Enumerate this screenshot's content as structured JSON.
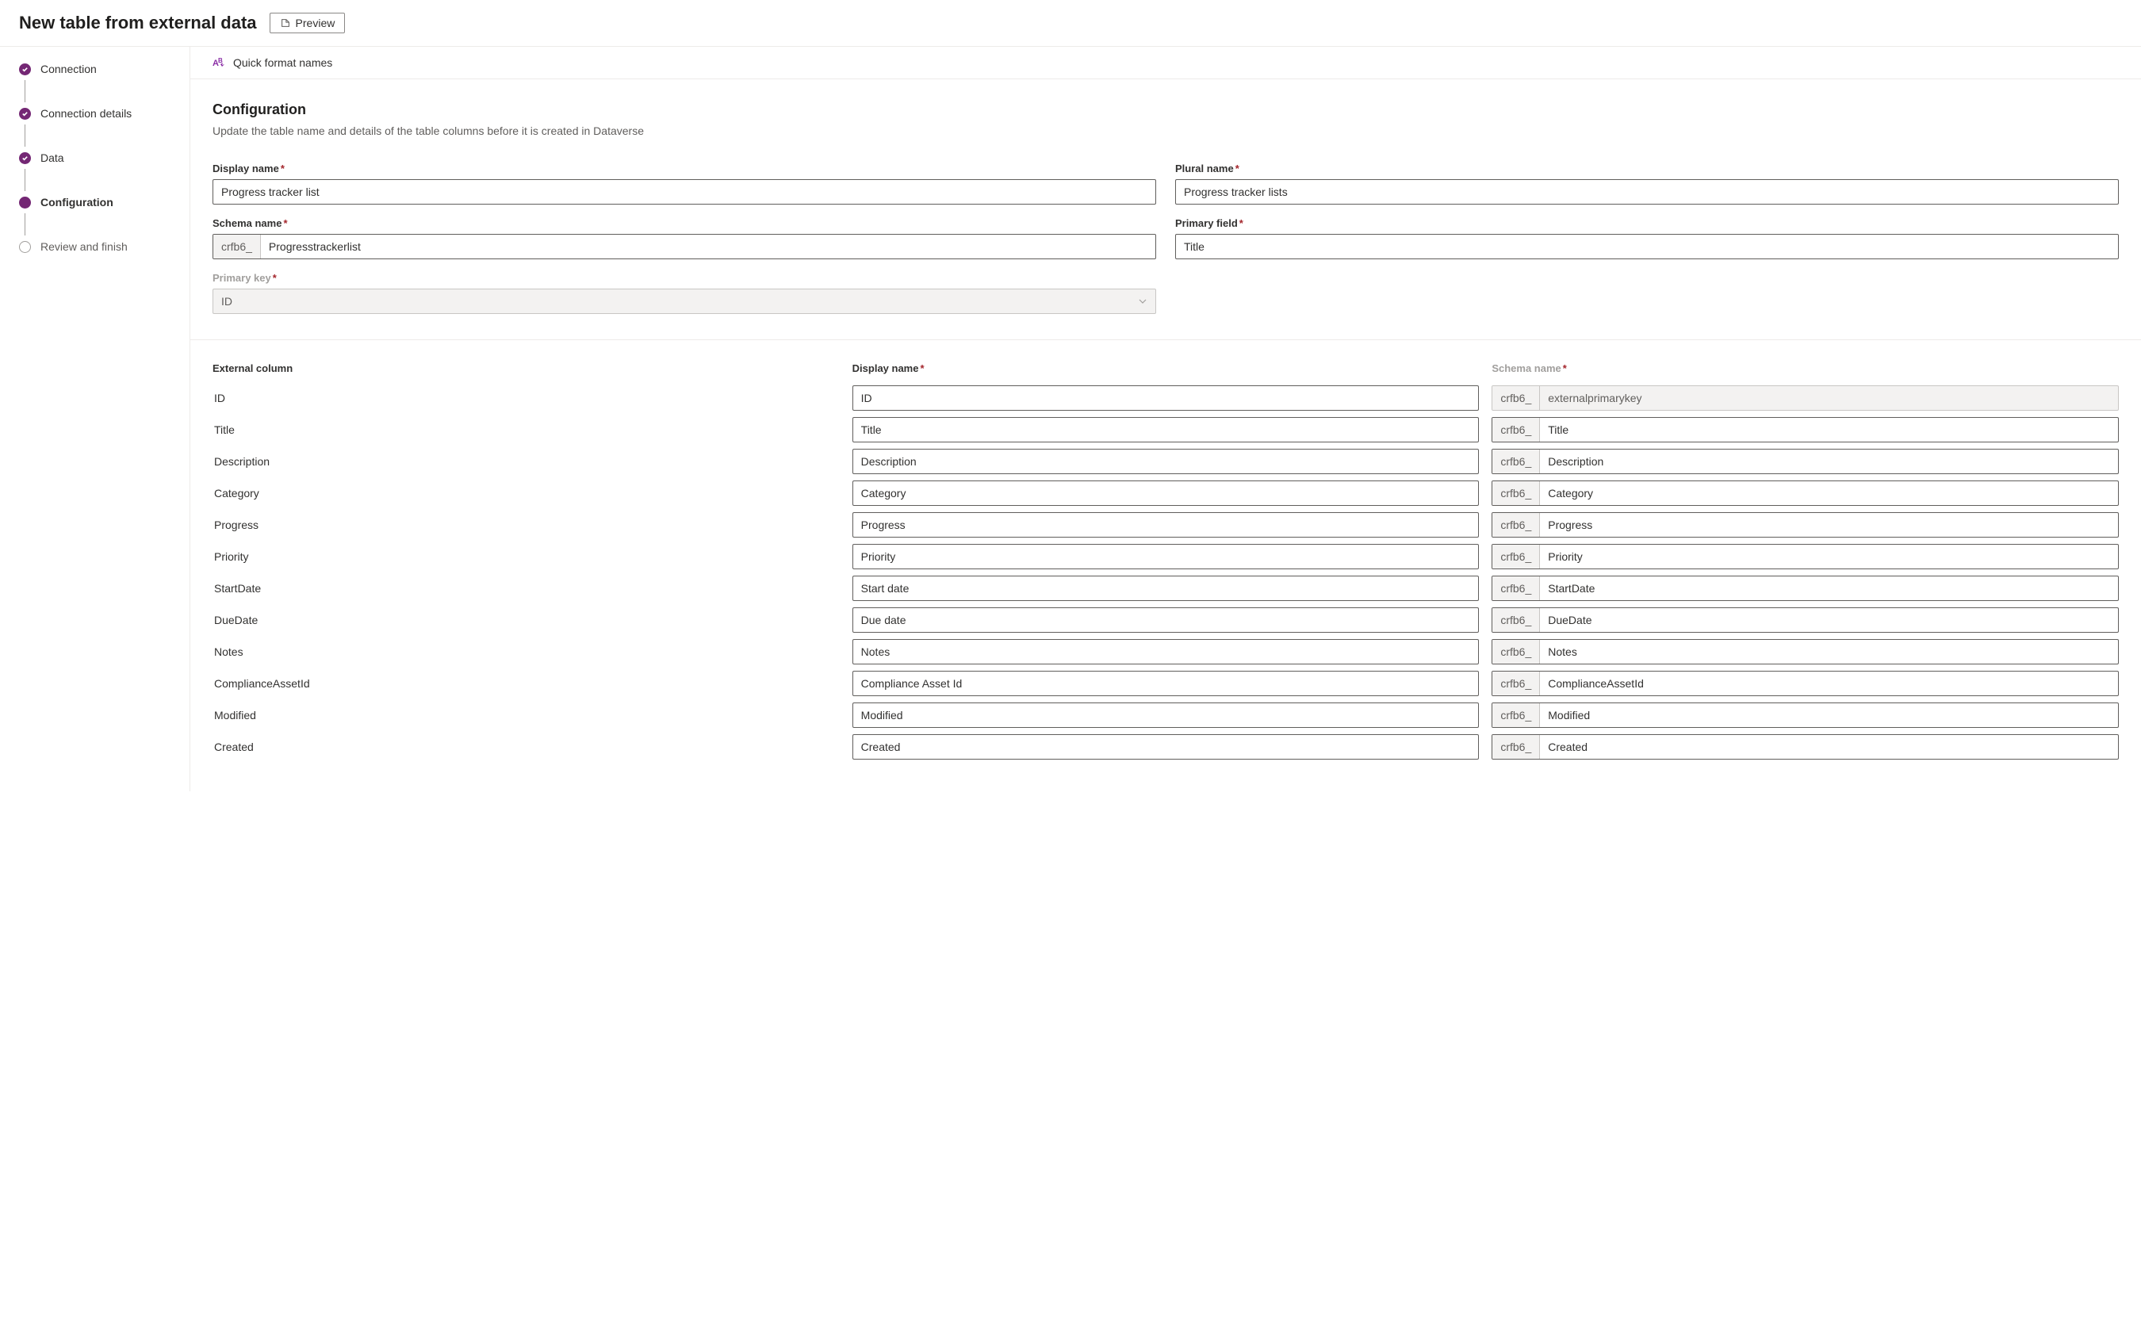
{
  "header": {
    "title": "New table from external data",
    "preview_label": "Preview"
  },
  "stepper": {
    "items": [
      {
        "label": "Connection",
        "state": "completed"
      },
      {
        "label": "Connection details",
        "state": "completed"
      },
      {
        "label": "Data",
        "state": "completed"
      },
      {
        "label": "Configuration",
        "state": "current"
      },
      {
        "label": "Review and finish",
        "state": "upcoming"
      }
    ]
  },
  "toolbar": {
    "quick_format_label": "Quick format names"
  },
  "configuration": {
    "title": "Configuration",
    "description": "Update the table name and details of the table columns before it is created in Dataverse",
    "labels": {
      "display_name": "Display name",
      "plural_name": "Plural name",
      "schema_name": "Schema name",
      "primary_field": "Primary field",
      "primary_key": "Primary key"
    },
    "values": {
      "display_name": "Progress tracker list",
      "plural_name": "Progress tracker lists",
      "schema_prefix": "crfb6_",
      "schema_name": "Progresstrackerlist",
      "primary_field": "Title",
      "primary_key": "ID"
    }
  },
  "columns": {
    "headers": {
      "external": "External column",
      "display": "Display name",
      "schema": "Schema name"
    },
    "schema_prefix": "crfb6_",
    "rows": [
      {
        "ext": "ID",
        "display": "ID",
        "schema": "externalprimarykey",
        "disabled": true
      },
      {
        "ext": "Title",
        "display": "Title",
        "schema": "Title",
        "disabled": false
      },
      {
        "ext": "Description",
        "display": "Description",
        "schema": "Description",
        "disabled": false
      },
      {
        "ext": "Category",
        "display": "Category",
        "schema": "Category",
        "disabled": false
      },
      {
        "ext": "Progress",
        "display": "Progress",
        "schema": "Progress",
        "disabled": false
      },
      {
        "ext": "Priority",
        "display": "Priority",
        "schema": "Priority",
        "disabled": false
      },
      {
        "ext": "StartDate",
        "display": "Start date",
        "schema": "StartDate",
        "disabled": false
      },
      {
        "ext": "DueDate",
        "display": "Due date",
        "schema": "DueDate",
        "disabled": false
      },
      {
        "ext": "Notes",
        "display": "Notes",
        "schema": "Notes",
        "disabled": false
      },
      {
        "ext": "ComplianceAssetId",
        "display": "Compliance Asset Id",
        "schema": "ComplianceAssetId",
        "disabled": false
      },
      {
        "ext": "Modified",
        "display": "Modified",
        "schema": "Modified",
        "disabled": false
      },
      {
        "ext": "Created",
        "display": "Created",
        "schema": "Created",
        "disabled": false
      }
    ]
  }
}
